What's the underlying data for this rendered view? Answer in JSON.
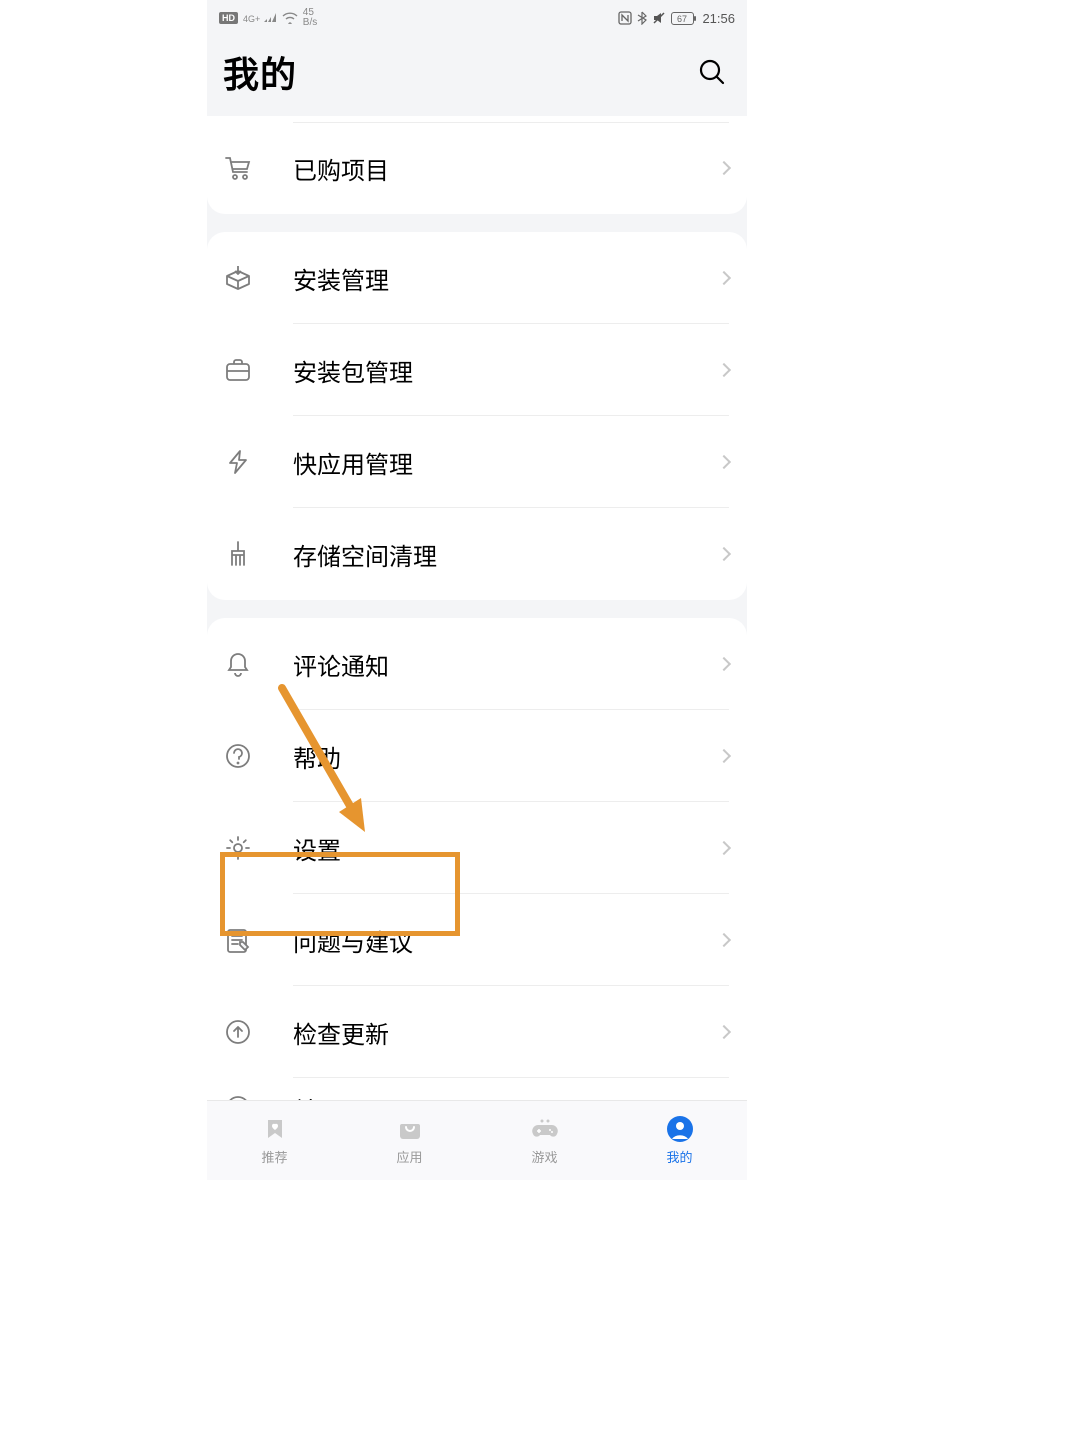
{
  "status_bar": {
    "hd": "HD",
    "signal_label": "4G+",
    "net_speed_top": "45",
    "net_speed_bottom": "B/s",
    "battery": "67",
    "time": "21:56"
  },
  "header": {
    "title": "我的"
  },
  "group1": {
    "purchased": "已购项目"
  },
  "group2": {
    "install_mgmt": "安装管理",
    "package_mgmt": "安装包管理",
    "quick_app_mgmt": "快应用管理",
    "storage_clean": "存储空间清理"
  },
  "group3": {
    "comment_notify": "评论通知",
    "help": "帮助",
    "settings": "设置",
    "feedback": "问题与建议",
    "check_update": "检查更新",
    "about": "关于"
  },
  "nav": {
    "recommend": "推荐",
    "apps": "应用",
    "games": "游戏",
    "me": "我的"
  },
  "colors": {
    "highlight": "#e6952f",
    "active_blue": "#1a73e8",
    "icon_gray": "#7d7d7d"
  },
  "annotation": {
    "highlighted_item": "settings"
  }
}
